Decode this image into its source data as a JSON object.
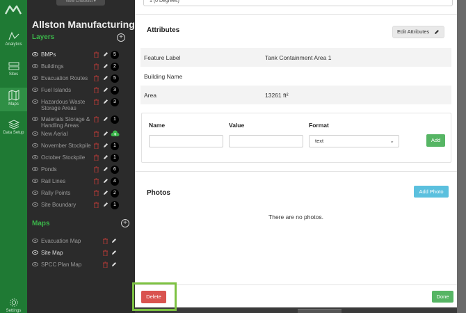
{
  "nav": {
    "items": [
      {
        "label": "Analytics",
        "icon": "chart-icon"
      },
      {
        "label": "Sites",
        "icon": "sites-icon"
      },
      {
        "label": "Maps",
        "icon": "map-icon"
      },
      {
        "label": "Data Setup",
        "icon": "layers-stack-icon"
      },
      {
        "label": "Settings",
        "icon": "gear-icon"
      }
    ]
  },
  "sidebar": {
    "checklist_label": "View Checklist ▾",
    "site_title": "Allston Manufacturing",
    "layers_title": "Layers",
    "maps_title": "Maps",
    "layers": [
      {
        "label": "BMPs",
        "count": "5"
      },
      {
        "label": "Buildings",
        "count": "2"
      },
      {
        "label": "Evacuation Routes",
        "count": "5"
      },
      {
        "label": "Fuel Islands",
        "count": "3"
      },
      {
        "label": "Hazardous Waste Storage Areas",
        "count": "3"
      },
      {
        "label": "Materials Storage & Handling Areas",
        "count": "1"
      },
      {
        "label": "New Aerial",
        "count": ""
      },
      {
        "label": "November Stockpile",
        "count": "1"
      },
      {
        "label": "October Stockpile",
        "count": "1"
      },
      {
        "label": "Ponds",
        "count": "6"
      },
      {
        "label": "Rail Lines",
        "count": "4"
      },
      {
        "label": "Rally Points",
        "count": "2"
      },
      {
        "label": "Site Boundary",
        "count": "1"
      }
    ],
    "maps": [
      {
        "label": "Evacuation Map"
      },
      {
        "label": "Site Map"
      },
      {
        "label": "SPCC Plan Map"
      }
    ]
  },
  "modal": {
    "top_select_value": "1 (0 Degrees)",
    "attributes_title": "Attributes",
    "edit_attributes_label": "Edit Attributes",
    "attributes": [
      {
        "key": "Feature Label",
        "value": "Tank Containment Area 1"
      },
      {
        "key": "Building Name",
        "value": ""
      },
      {
        "key": "Area",
        "value": "13261 ft²"
      }
    ],
    "form": {
      "name_label": "Name",
      "value_label": "Value",
      "format_label": "Format",
      "format_value": "text",
      "add_label": "Add"
    },
    "photos_title": "Photos",
    "add_photo_label": "Add Photo",
    "photos_empty": "There are no photos.",
    "delete_label": "Delete",
    "done_label": "Done"
  },
  "colors": {
    "brand_green": "#1f7a34",
    "section_green": "#3bb54a",
    "danger": "#d9534f",
    "success": "#56b564",
    "info": "#5bc0de",
    "highlight": "#7dc242"
  }
}
